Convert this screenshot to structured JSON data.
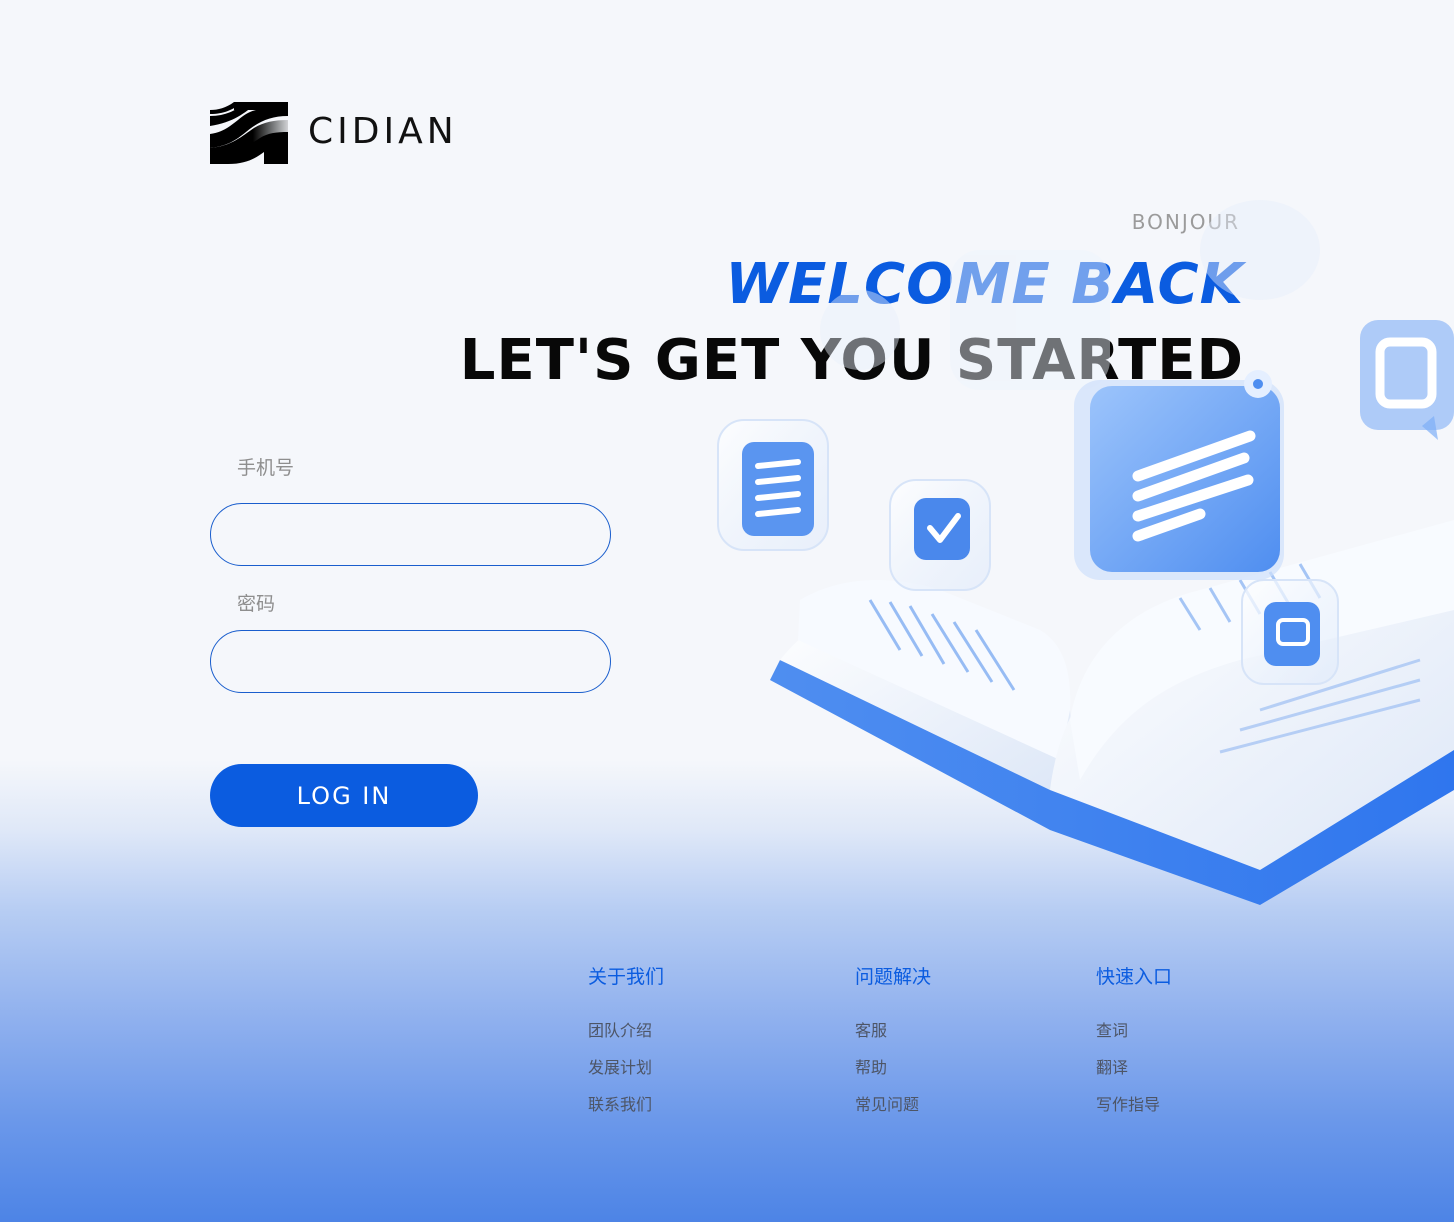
{
  "brand": {
    "name": "CIDIAN"
  },
  "hero": {
    "greeting": "BONJOUR",
    "headline": "WELCOME BACK",
    "subheadline": "LET'S GET YOU STARTED"
  },
  "form": {
    "phone_label": "手机号",
    "phone_value": "",
    "password_label": "密码",
    "password_value": "",
    "login_label": "LOG IN"
  },
  "footer": {
    "columns": [
      {
        "heading": "关于我们",
        "links": [
          "团队介绍",
          "发展计划",
          "联系我们"
        ]
      },
      {
        "heading": "问题解决",
        "links": [
          "客服",
          "帮助",
          "常见问题"
        ]
      },
      {
        "heading": "快速入口",
        "links": [
          "查词",
          "翻译",
          "写作指导"
        ]
      }
    ]
  },
  "colors": {
    "accent": "#0b5ce0",
    "text_dark": "#080808",
    "muted": "#8e8e8e",
    "footer_link": "#4d5566"
  },
  "illustration": {
    "icons": [
      "open-book-icon",
      "document-icon",
      "checkmark-icon",
      "chat-bubble-icon",
      "message-card-icon",
      "window-icon"
    ]
  }
}
